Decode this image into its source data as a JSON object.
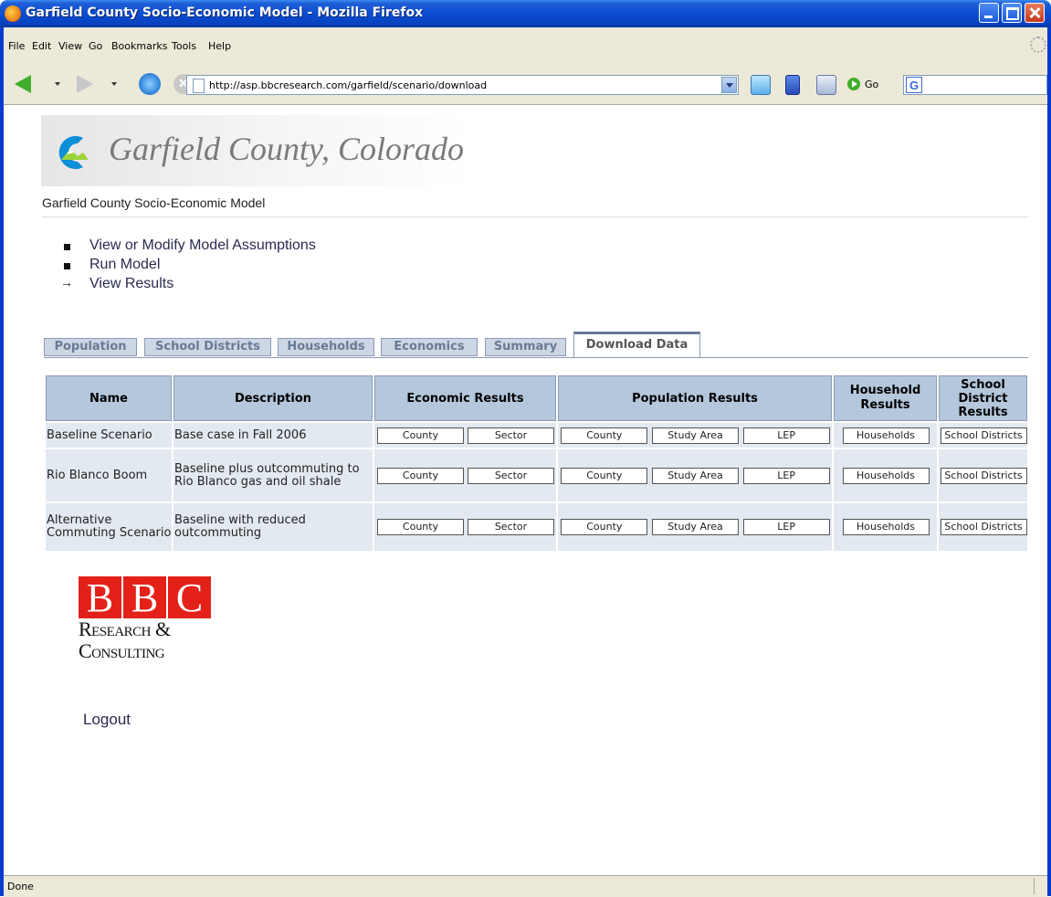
{
  "window": {
    "title": "Garfield County Socio-Economic Model - Mozilla Firefox"
  },
  "menu": [
    "File",
    "Edit",
    "View",
    "Go",
    "Bookmarks",
    "Tools",
    "Help"
  ],
  "toolbar": {
    "url": "http://asp.bbcresearch.com/garfield/scenario/download",
    "go_label": "Go"
  },
  "header": {
    "logo_text": "Garfield County, Colorado",
    "site_title": "Garfield County Socio-Economic Model"
  },
  "nav": {
    "items": [
      {
        "label": "View or Modify Model Assumptions"
      },
      {
        "label": "Run Model"
      },
      {
        "label": "View Results"
      }
    ]
  },
  "tabs": [
    "Population",
    "School Districts",
    "Households",
    "Economics",
    "Summary",
    "Download Data"
  ],
  "table": {
    "headers": {
      "name": "Name",
      "description": "Description",
      "economic": "Economic Results",
      "population": "Population Results",
      "household": "Household Results",
      "school": "School District Results"
    },
    "buttons": {
      "county": "County",
      "sector": "Sector",
      "study_area": "Study Area",
      "lep": "LEP",
      "households": "Households",
      "school_districts": "School Districts"
    },
    "rows": [
      {
        "name": "Baseline Scenario",
        "description": "Base case in Fall 2006"
      },
      {
        "name": "Rio Blanco Boom",
        "description": "Baseline plus outcommuting to Rio Blanco gas and oil shale"
      },
      {
        "name": "Alternative Commuting Scenario",
        "description": "Baseline with reduced outcommuting"
      }
    ]
  },
  "footer": {
    "bbc_letters": [
      "B",
      "B",
      "C"
    ],
    "bbc_line1": "Research &",
    "bbc_line2": "Consulting",
    "logout": "Logout"
  },
  "status": {
    "text": "Done"
  },
  "colors": {
    "titlebar": "#0a4cd1",
    "tab_active_border": "#6a7a9a",
    "table_header": "#b5c7dc",
    "table_cell": "#e3e9f0",
    "bbc_red": "#e32119"
  }
}
